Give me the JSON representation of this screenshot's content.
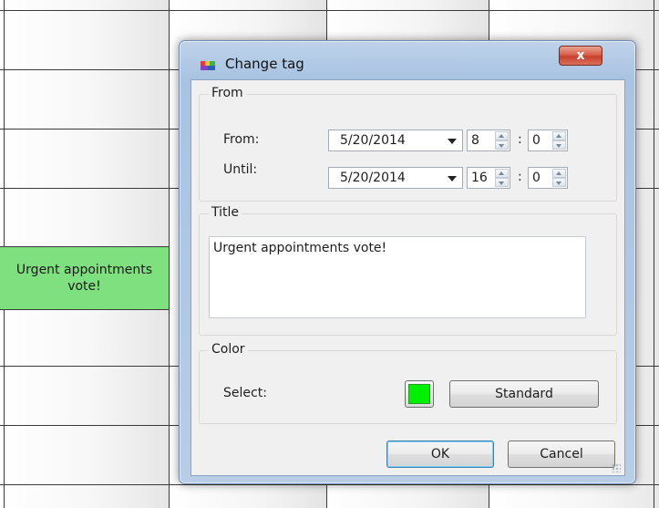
{
  "background": {
    "tag_text": "Urgent appointments vote!",
    "tag_color": "#7ee07e"
  },
  "dialog": {
    "title": "Change tag",
    "icon": "app-icon",
    "close_icon": "close-x-icon",
    "close_label": "x",
    "from_group": {
      "title": "From",
      "from_label": "From:",
      "from_date": "5/20/2014",
      "from_hour": "8",
      "from_minute": "0",
      "until_label": "Until:",
      "until_date": "5/20/2014",
      "until_hour": "16",
      "until_minute": "0",
      "separator": ":"
    },
    "title_group": {
      "title": "Title",
      "value": "Urgent appointments vote!"
    },
    "color_group": {
      "title": "Color",
      "select_label": "Select:",
      "selected_color": "#00f000",
      "standard_button": "Standard"
    },
    "ok_button": "OK",
    "cancel_button": "Cancel"
  }
}
